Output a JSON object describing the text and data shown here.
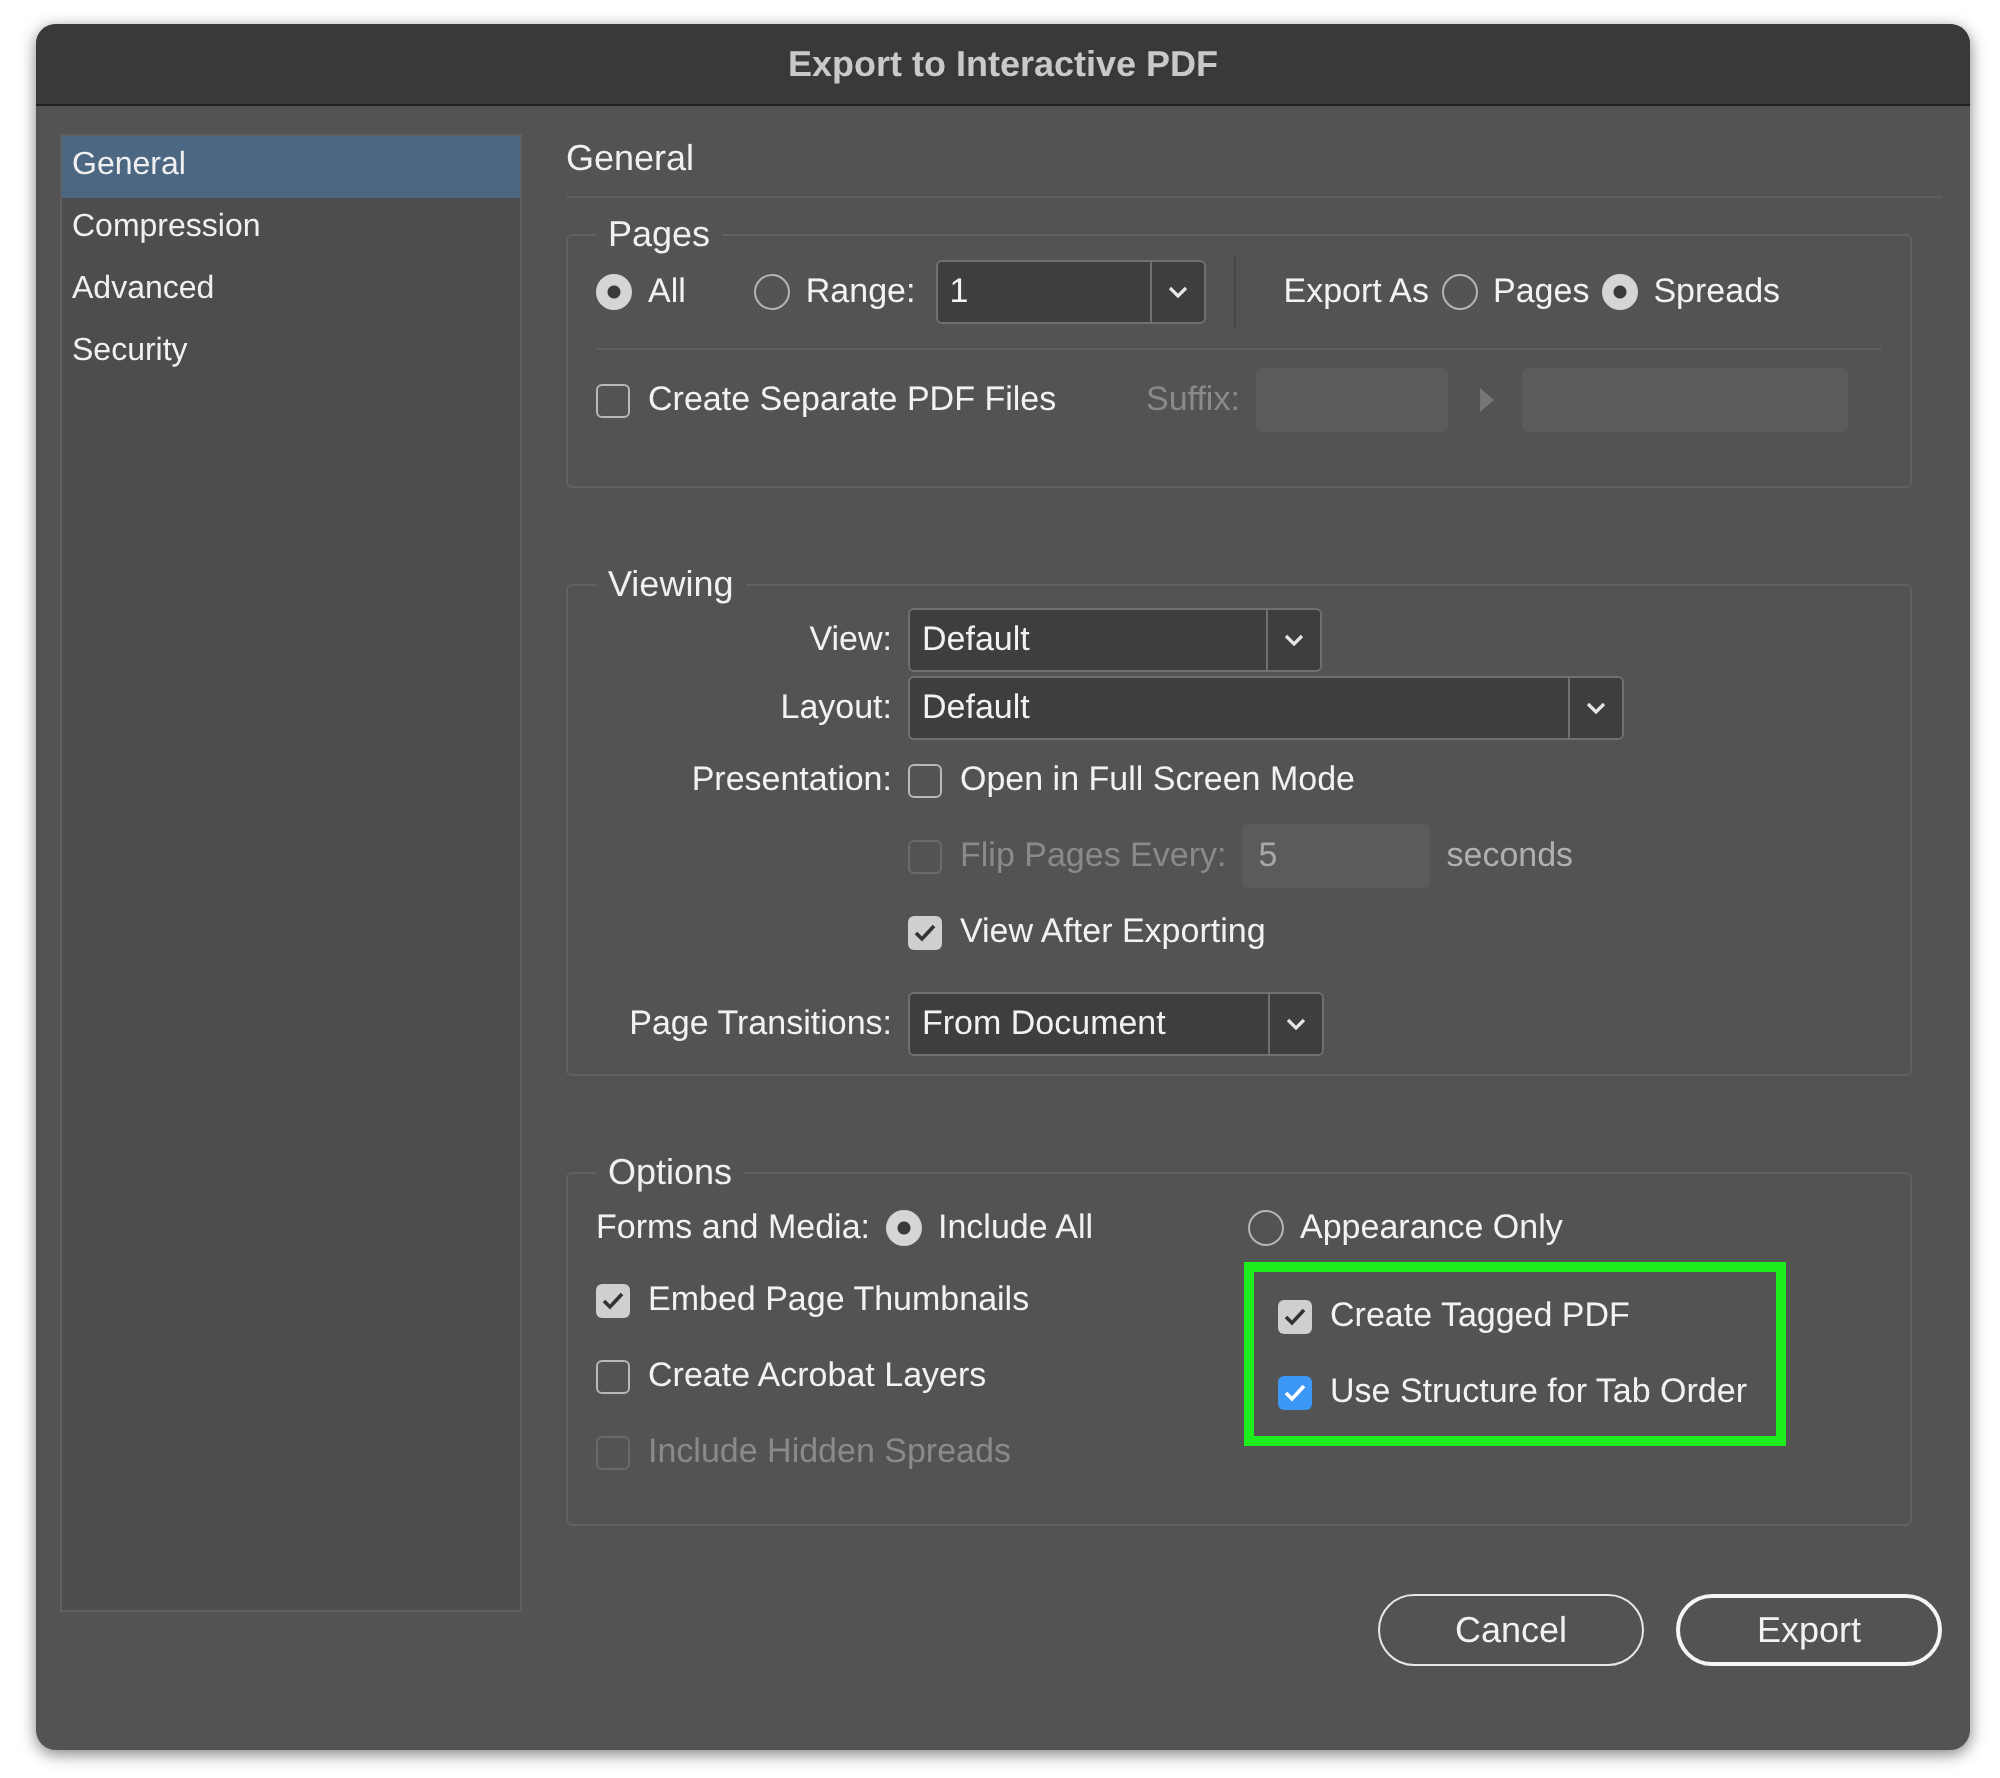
{
  "window": {
    "title": "Export to Interactive PDF"
  },
  "sidebar": {
    "items": [
      {
        "label": "General",
        "selected": true
      },
      {
        "label": "Compression",
        "selected": false
      },
      {
        "label": "Advanced",
        "selected": false
      },
      {
        "label": "Security",
        "selected": false
      }
    ]
  },
  "panel_title": "General",
  "pages": {
    "legend": "Pages",
    "scope": [
      {
        "label": "All",
        "selected": true
      },
      {
        "label": "Range:",
        "selected": false
      }
    ],
    "range_value": "1",
    "export_as": {
      "label": "Export As",
      "options": [
        {
          "label": "Pages",
          "selected": false
        },
        {
          "label": "Spreads",
          "selected": true
        }
      ]
    },
    "separate_files": {
      "label": "Create Separate PDF Files",
      "checked": false
    },
    "suffix": {
      "label": "Suffix:",
      "disabled": true
    }
  },
  "viewing": {
    "legend": "Viewing",
    "view": {
      "label": "View:",
      "value": "Default"
    },
    "layout": {
      "label": "Layout:",
      "value": "Default"
    },
    "presentation": {
      "label": "Presentation:",
      "items": [
        {
          "kind": "check",
          "label": "Open in Full Screen Mode",
          "checked": false,
          "disabled": false
        },
        {
          "kind": "timer",
          "label": "Flip Pages Every:",
          "checked": false,
          "disabled": true,
          "value": "5",
          "unit": "seconds"
        },
        {
          "kind": "check",
          "label": "View After Exporting",
          "checked": true,
          "disabled": false
        }
      ]
    },
    "transitions": {
      "label": "Page Transitions:",
      "value": "From Document"
    }
  },
  "options": {
    "legend": "Options",
    "forms_media": {
      "label": "Forms and Media:",
      "options": [
        {
          "label": "Include All",
          "selected": true
        },
        {
          "label": "Appearance Only",
          "selected": false
        }
      ]
    },
    "left_checks": [
      {
        "label": "Embed Page Thumbnails",
        "checked": true,
        "disabled": false
      },
      {
        "label": "Create Acrobat Layers",
        "checked": false,
        "disabled": false
      },
      {
        "label": "Include Hidden Spreads",
        "checked": false,
        "disabled": true
      }
    ],
    "tagging": {
      "highlighted": true,
      "checks": [
        {
          "label": "Create Tagged PDF",
          "checked": true,
          "focused": false
        },
        {
          "label": "Use Structure for Tab Order",
          "checked": true,
          "focused": true
        }
      ]
    }
  },
  "buttons": [
    {
      "label": "Cancel",
      "default": false
    },
    {
      "label": "Export",
      "default": true
    }
  ]
}
